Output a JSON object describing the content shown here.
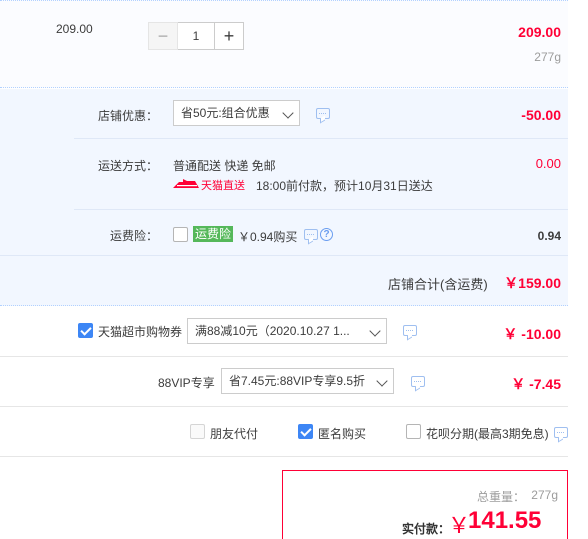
{
  "item": {
    "unit_price": "209.00",
    "quantity": "1",
    "minus": "−",
    "plus": "+",
    "total": "209.00",
    "weight": "277g"
  },
  "shop_discount": {
    "label": "店铺优惠：",
    "select": "省50元:组合优惠",
    "amount": "-50.00"
  },
  "shipping": {
    "label": "运送方式：",
    "method": "普通配送 快递 免邮",
    "tmall_tag": "天猫直送",
    "delivery": "18:00前付款，预计10月31日送达",
    "amount": "0.00"
  },
  "insurance": {
    "label": "运费险：",
    "tag": "运费险",
    "price": "￥0.94购买",
    "amount": "0.94",
    "help": "?"
  },
  "shop_total": {
    "label": "店铺合计(含运费)",
    "amount": "￥159.00"
  },
  "coupon": {
    "label": "天猫超市购物券",
    "select": "满88减10元（2020.10.27 1...",
    "amount": "￥ -10.00"
  },
  "vip": {
    "label": "88VIP专享",
    "select": "省7.45元:88VIP专享9.5折",
    "amount": "￥ -7.45"
  },
  "options": {
    "friend_pay": "朋友代付",
    "anonymous": "匿名购买",
    "huabei": "花呗分期(最高3期免息)"
  },
  "summary": {
    "weight_label": "总重量：",
    "weight": "277g",
    "pay_label": "实付款：",
    "currency": "￥",
    "pay_amount": "141.55"
  },
  "colors": {
    "accent_red": "#ff0036",
    "accent_blue": "#3d86f5",
    "freight_green": "#55b85a"
  }
}
